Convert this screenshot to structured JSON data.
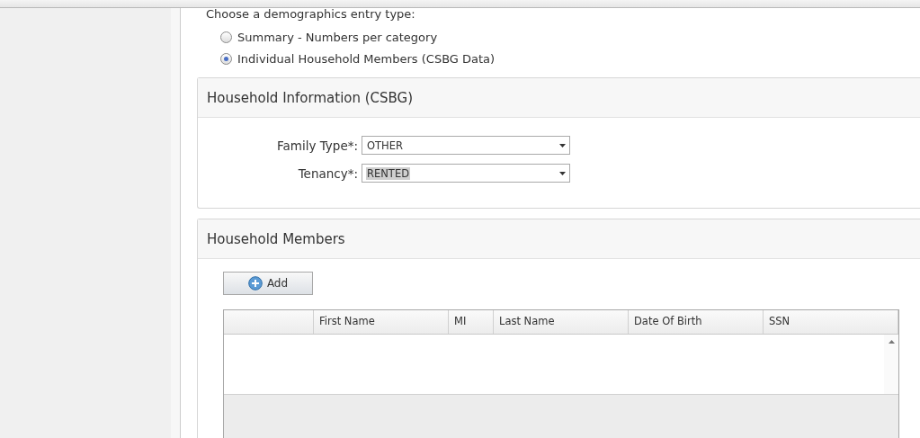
{
  "entry_type": {
    "prompt": "Choose a demographics entry type:",
    "options": [
      {
        "label": "Summary - Numbers per category",
        "selected": false
      },
      {
        "label": "Individual Household Members (CSBG Data)",
        "selected": true
      }
    ]
  },
  "household_information": {
    "title": "Household Information (CSBG)",
    "fields": [
      {
        "label": "Family Type*:",
        "value": "OTHER",
        "highlighted": false
      },
      {
        "label": "Tenancy*:",
        "value": "RENTED",
        "highlighted": true
      }
    ]
  },
  "household_members": {
    "title": "Household Members",
    "add_button": "Add",
    "table": {
      "columns": [
        "",
        "First Name",
        "MI",
        "Last Name",
        "Date Of Birth",
        "SSN"
      ]
    }
  }
}
